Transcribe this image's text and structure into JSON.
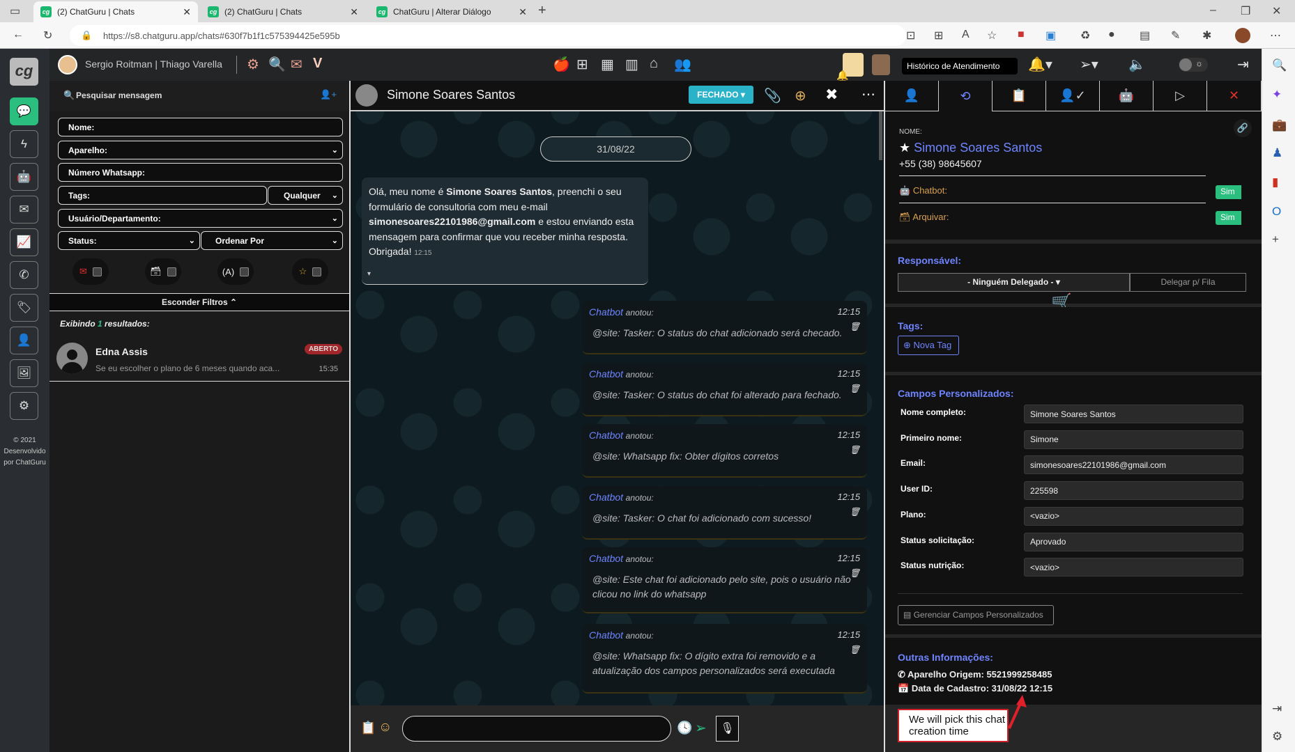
{
  "browser": {
    "tabs": [
      {
        "title": "(2) ChatGuru | Chats"
      },
      {
        "title": "(2) ChatGuru | Chats"
      },
      {
        "title": "ChatGuru | Alterar Diálogo"
      }
    ],
    "favicon": "cg",
    "url": "https://s8.chatguru.app/chats#630f7b1f1c575394425e595b"
  },
  "app": {
    "logo": "cg",
    "users": "Sergio Roitman | Thiago Varella",
    "copyright": "© 2021 Desenvolvido por ChatGuru",
    "tooltip": "Histórico de Atendimento"
  },
  "left": {
    "search_placeholder": "Pesquisar mensagem",
    "filters": {
      "nome": "Nome:",
      "aparelho": "Aparelho:",
      "numero": "Número Whatsapp:",
      "tags": "Tags:",
      "qualquer": "Qualquer",
      "usuario": "Usuário/Departamento:",
      "status": "Status:",
      "ordenar": "Ordenar Por"
    },
    "hide_filters": "Esconder Filtros ⌃",
    "results_prefix": "Exibindo ",
    "results_count": "1",
    "results_suffix": " resultados:",
    "contacts": [
      {
        "name": "Edna Assis",
        "preview": "Se eu escolher o plano de 6 meses quando aca...",
        "badge": "ABERTO",
        "time": "15:35"
      }
    ]
  },
  "chat": {
    "contact": "Simone Soares Santos",
    "status_button": "FECHADO",
    "date": "31/08/22",
    "message": {
      "p1": "Olá, meu nome é ",
      "name": "Simone Soares Santos",
      "p2": ", preenchi o seu formulário de consultoria com meu e-mail ",
      "email": "simonesoares22101986@gmail.com",
      "p3": " e estou enviando esta mensagem para confirmar que vou receber minha resposta. Obrigada!",
      "time": "12:15"
    },
    "annotations": [
      {
        "who": "Chatbot",
        "action": "anotou:",
        "time": "12:15",
        "text": "@site: Tasker: O status do chat adicionado será checado."
      },
      {
        "who": "Chatbot",
        "action": "anotou:",
        "time": "12:15",
        "text": "@site: Tasker: O status do chat foi alterado para fechado."
      },
      {
        "who": "Chatbot",
        "action": "anotou:",
        "time": "12:15",
        "text": "@site: Whatsapp fix: Obter dígitos corretos"
      },
      {
        "who": "Chatbot",
        "action": "anotou:",
        "time": "12:15",
        "text": "@site: Tasker: O chat foi adicionado com sucesso!"
      },
      {
        "who": "Chatbot",
        "action": "anotou:",
        "time": "12:15",
        "text": "@site: Este chat foi adicionado pelo site, pois o usuário não clicou no link do whatsapp"
      },
      {
        "who": "Chatbot",
        "action": "anotou:",
        "time": "12:15",
        "text": "@site: Whatsapp fix: O dígito extra foi removido e a atualização dos campos personalizados será executada"
      }
    ]
  },
  "right": {
    "nome_label": "NOME:",
    "name": "Simone Soares Santos",
    "phone": "+55 (38) 98645607",
    "chatbot_label": "Chatbot:",
    "chatbot_value": "Sim",
    "arquivar_label": "Arquivar:",
    "arquivar_value": "Sim",
    "responsavel_label": "Responsável:",
    "responsavel_value": "- Ninguém Delegado -",
    "delegar": "Delegar p/ Fila",
    "tags_label": "Tags:",
    "nova_tag": "Nova Tag",
    "campos_label": "Campos Personalizados:",
    "fields": [
      {
        "label": "Nome completo:",
        "value": "Simone Soares Santos"
      },
      {
        "label": "Primeiro nome:",
        "value": "Simone"
      },
      {
        "label": "Email:",
        "value": "simonesoares22101986@gmail.com"
      },
      {
        "label": "User ID:",
        "value": "225598"
      },
      {
        "label": "Plano:",
        "value": "<vazio>"
      },
      {
        "label": "Status solicitação:",
        "value": "Aprovado"
      },
      {
        "label": "Status nutrição:",
        "value": "<vazio>"
      }
    ],
    "gerenciar": "Gerenciar Campos Personalizados",
    "outras_label": "Outras Informações:",
    "aparelho": "Aparelho Origem: 5521999258485",
    "cadastro": "Data de Cadastro: 31/08/22 12:15"
  },
  "callout": "We will pick this chat creation time",
  "colors": {
    "accent": "#6f84ff",
    "green": "#2bbf7f",
    "teal": "#2ab3c8",
    "red": "#e0302b"
  }
}
